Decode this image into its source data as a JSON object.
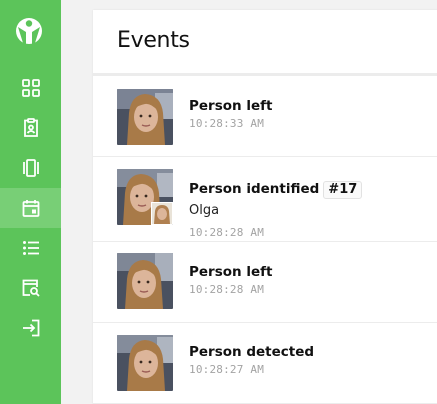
{
  "brand": {
    "logo_icon": "person-circle-logo",
    "sidebar_color": "#5cc45a",
    "active_color": "#78cf76"
  },
  "nav": [
    {
      "icon": "grid-icon",
      "active": false
    },
    {
      "icon": "badge-icon",
      "active": false
    },
    {
      "icon": "panels-icon",
      "active": false
    },
    {
      "icon": "calendar-icon",
      "active": true
    },
    {
      "icon": "list-icon",
      "active": false
    },
    {
      "icon": "search-doc-icon",
      "active": false
    },
    {
      "icon": "login-icon",
      "active": false
    }
  ],
  "page": {
    "title": "Events"
  },
  "events": [
    {
      "title": "Person left",
      "badge": "",
      "subtitle": "",
      "time": "10:28:33 AM"
    },
    {
      "title": "Person identified",
      "badge": "#17",
      "subtitle": "Olga",
      "time": "10:28:28 AM"
    },
    {
      "title": "Person left",
      "badge": "",
      "subtitle": "",
      "time": "10:28:28 AM"
    },
    {
      "title": "Person detected",
      "badge": "",
      "subtitle": "",
      "time": "10:28:27 AM"
    }
  ]
}
